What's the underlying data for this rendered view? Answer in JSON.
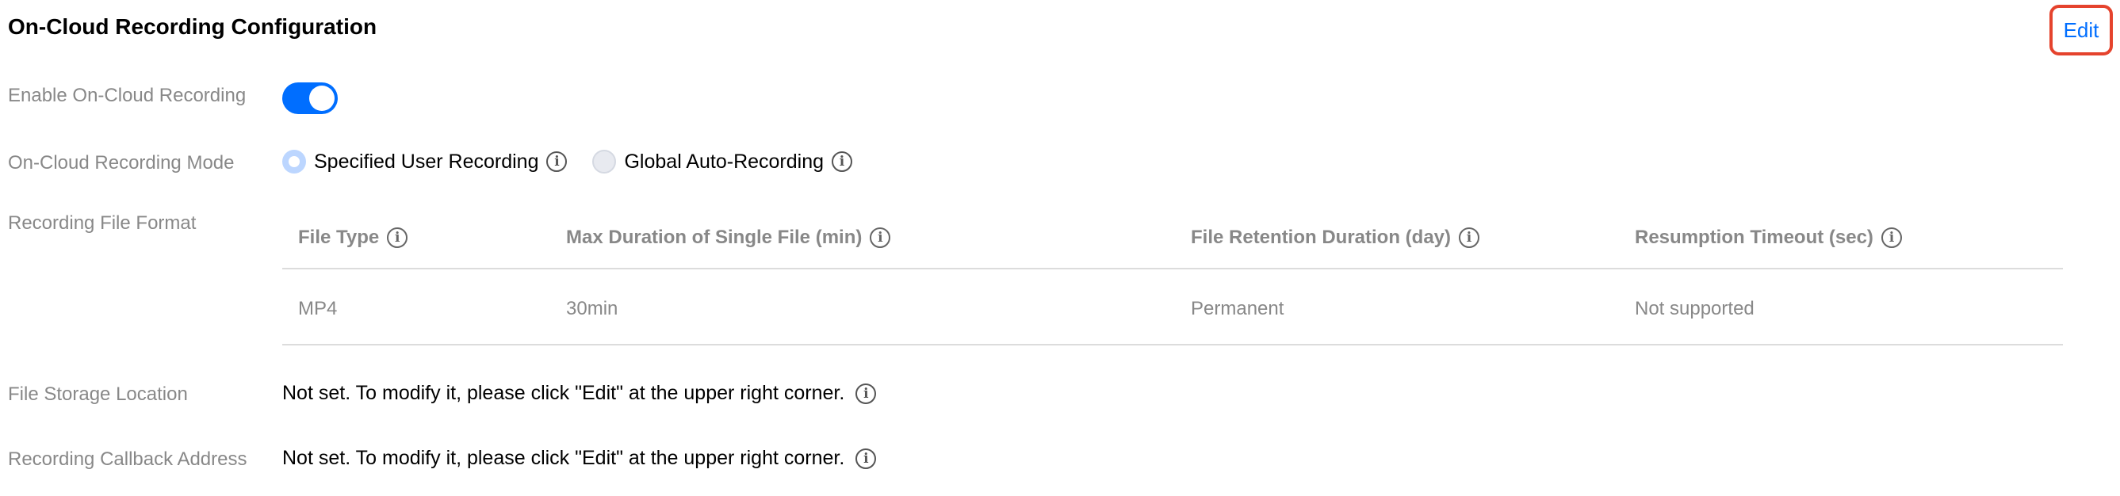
{
  "header": {
    "title": "On-Cloud Recording Configuration",
    "edit_label": "Edit"
  },
  "enable_recording": {
    "label": "Enable On-Cloud Recording",
    "enabled": true
  },
  "recording_mode": {
    "label": "On-Cloud Recording Mode",
    "options": [
      {
        "label": "Specified User Recording",
        "selected": true
      },
      {
        "label": "Global Auto-Recording",
        "selected": false
      }
    ]
  },
  "file_format": {
    "label": "Recording File Format",
    "columns": [
      "File Type",
      "Max Duration of Single File (min)",
      "File Retention Duration (day)",
      "Resumption Timeout (sec)"
    ],
    "rows": [
      [
        "MP4",
        "30min",
        "Permanent",
        "Not supported"
      ]
    ]
  },
  "storage_location": {
    "label": "File Storage Location",
    "value": "Not set. To modify it, please click \"Edit\" at the upper right corner."
  },
  "callback_address": {
    "label": "Recording Callback Address",
    "value": "Not set. To modify it, please click \"Edit\" at the upper right corner."
  },
  "colors": {
    "accent": "#006eff",
    "highlight_border": "#e5432d",
    "label_gray": "#888888"
  },
  "icons": {
    "info": "info-circle-icon"
  }
}
